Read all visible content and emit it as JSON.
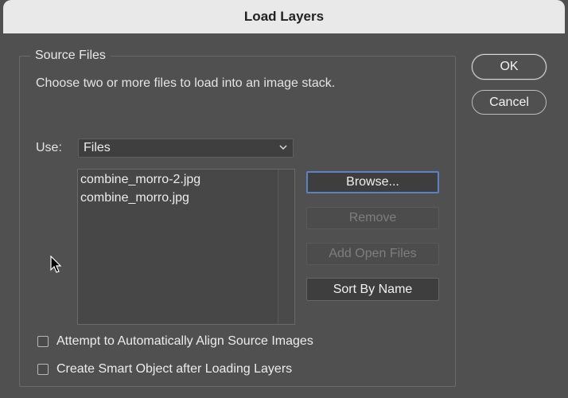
{
  "window": {
    "title": "Load Layers"
  },
  "source_files": {
    "group_label": "Source Files",
    "instruction": "Choose two or more files to load into an image stack.",
    "use_label": "Use:",
    "use_select": {
      "selected": "Files",
      "icon": "chevron-down-icon"
    },
    "files": [
      "combine_morro-2.jpg",
      "combine_morro.jpg"
    ]
  },
  "buttons": {
    "browse": "Browse...",
    "remove": "Remove",
    "add_open_files": "Add Open Files",
    "sort_by_name": "Sort By Name",
    "ok": "OK",
    "cancel": "Cancel"
  },
  "options": {
    "align_label": "Attempt to Automatically Align Source Images",
    "align_checked": false,
    "smart_object_label": "Create Smart Object after Loading Layers",
    "smart_object_checked": false
  },
  "colors": {
    "dialog_bg": "#505050",
    "titlebar_bg": "#e9e9e9",
    "focus_ring": "#5b82c5"
  }
}
